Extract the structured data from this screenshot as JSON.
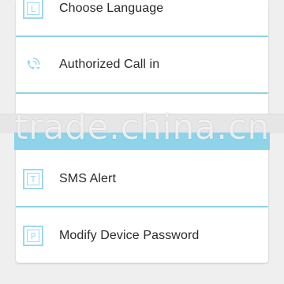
{
  "menu": {
    "items": [
      {
        "label": "Choose Language",
        "icon": "language-icon",
        "glyph": "L"
      },
      {
        "label": "Authorized Call in",
        "icon": "phone-icon"
      },
      {
        "label": "SMS Alert",
        "icon": "sms-icon",
        "glyph": "T"
      },
      {
        "label": "Modify Device Password",
        "icon": "password-icon",
        "glyph": "P"
      }
    ]
  },
  "watermark": "trade.china.cn",
  "colors": {
    "accent": "#8fd2e6",
    "icon": "#9ed8e8",
    "text": "#2a2a2a",
    "background": "#efefef",
    "card": "#ffffff"
  }
}
